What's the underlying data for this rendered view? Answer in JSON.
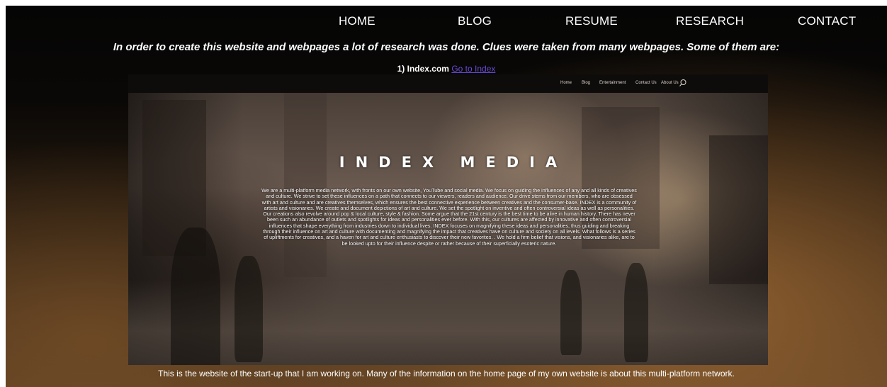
{
  "nav": {
    "items": [
      {
        "label": "HOME"
      },
      {
        "label": "BLOG"
      },
      {
        "label": "RESUME"
      },
      {
        "label": "RESEARCH"
      },
      {
        "label": "CONTACT"
      }
    ]
  },
  "intro": "In order to create this website and webpages a lot of research was done. Clues were taken from many webpages. Some of them are:",
  "item": {
    "title": "1) Index.com",
    "link_label": "Go to Index"
  },
  "screenshot": {
    "nav": [
      "Home",
      "Blog",
      "Entertainment",
      "Contact Us",
      "About Us"
    ],
    "search_icon": "search-icon",
    "brand": "INDEX MEDIA",
    "description": "We are a multi-platform media network, with fronts on our own website, YouTube and social media. We focus on guiding the influences of any and all kinds of creatives and culture. We strive to set these influences on a path that connects to our viewers, readers and audience. Our drive stems from our members, who are obsessed with art and culture and are creatives themselves, which ensures the best connective experience between creatives and the consumer-base. INDEX is a community of artists and visionaries. We create and document depictions of art and culture. We set the spotlight on inventive and often controversial ideas as well as personalities. Our creations also revolve around pop & local culture, style & fashion. Some argue that the 21st century is the best time to be alive in human history. There has never been such an abundance of outlets and spotlights for ideas and personalities ever before. With this, our cultures are affected by innovative and often controversial influences that shape everything from industries down to individual lives. INDEX focuses on magnifying these ideas and personalities, thus guiding and breaking through their influence on art and culture with documenting and magnifying the impact that creatives have on culture and society on all levels. What follows is a series of upliftments for creatives, and a haven for art and culture enthusiasts to discover their new favorites. . We hold a firm belief that visions, and visionaries alike, are to be looked upto for their influence despite or rather because of their superficially esoteric nature."
  },
  "caption": "This is the website of the start-up that I am working on. Many of the information on the home page of my own website is about this multi-platform network."
}
